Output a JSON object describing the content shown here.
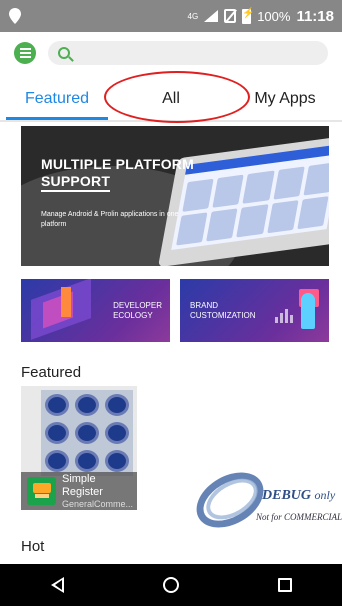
{
  "status_bar": {
    "network": "4G",
    "battery": "100%",
    "time": "11:18"
  },
  "tabs": [
    {
      "label": "Featured",
      "active": true
    },
    {
      "label": "All",
      "active": false
    },
    {
      "label": "My Apps",
      "active": false
    }
  ],
  "banner": {
    "title_line1": "MULTIPLE PLATFORM",
    "title_line2": "SUPPORT",
    "subtitle": "Manage Android & Prolin applications in one platform"
  },
  "promo_left": {
    "line1": "DEVELOPER",
    "line2": "ECOLOGY"
  },
  "promo_right": {
    "line1": "BRAND",
    "line2": "CUSTOMIZATION"
  },
  "sections": {
    "featured": "Featured",
    "hot": "Hot"
  },
  "featured_app": {
    "name": "Simple Register",
    "developer": "GeneralComme..."
  },
  "watermark": {
    "debug": "DEBUG",
    "only": "only",
    "note": "Not for COMMERCIAL"
  },
  "colors": {
    "accent": "#1e88e5",
    "menu_green": "#4caf50",
    "highlight_red": "#e02020",
    "status_bar": "#878787"
  }
}
